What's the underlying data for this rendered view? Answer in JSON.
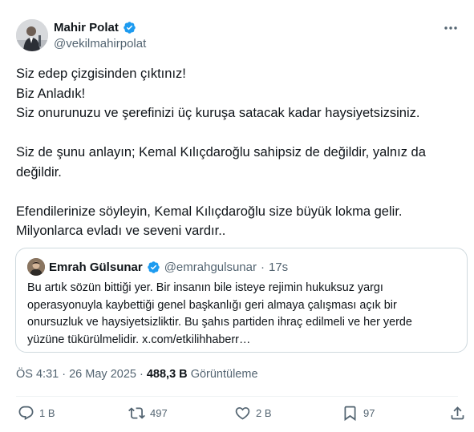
{
  "author": {
    "name": "Mahir Polat",
    "handle": "@vekilmahirpolat",
    "verified_color": "#1d9bf0"
  },
  "post": {
    "lines": [
      "Siz edep çizgisinden çıktınız!",
      "Biz Anladık!",
      "Siz onurunuzu ve şerefinizi üç kuruşa satacak kadar haysiyetsizsiniz.",
      "",
      "Siz de şunu anlayın; Kemal Kılıçdaroğlu sahipsiz de değildir, yalnız da",
      "değildir.",
      "",
      "Efendilerinize söyleyin, Kemal Kılıçdaroğlu size büyük lokma gelir.",
      "Milyonlarca evladı ve seveni vardır.."
    ]
  },
  "quote": {
    "name": "Emrah Gülsunar",
    "handle": "@emrahgulsunar",
    "separator": "·",
    "time": "17s",
    "lines": [
      "Bu artık sözün bittiği yer. Bir insanın bile isteye rejimin hukuksuz yargı",
      "operasyonuyla kaybettiği genel başkanlığı geri almaya çalışması açık bir",
      "onursuzluk ve haysiyetsizliktir. Bu şahıs partiden ihraç edilmeli ve her yerde",
      "yüzüne tükürülmelidir. x.com/etkilihhaberr…"
    ]
  },
  "meta": {
    "time": "ÖS 4:31",
    "sep1": "·",
    "date": "26 May 2025",
    "sep2": "·",
    "views_count": "488,3 B",
    "views_label": "Görüntüleme"
  },
  "actions": {
    "replies": "1 B",
    "reposts": "497",
    "likes": "2 B",
    "bookmarks": "97"
  },
  "icons": [
    "more-icon",
    "verified-badge-icon",
    "reply-icon",
    "repost-icon",
    "like-icon",
    "bookmark-icon",
    "share-icon"
  ]
}
